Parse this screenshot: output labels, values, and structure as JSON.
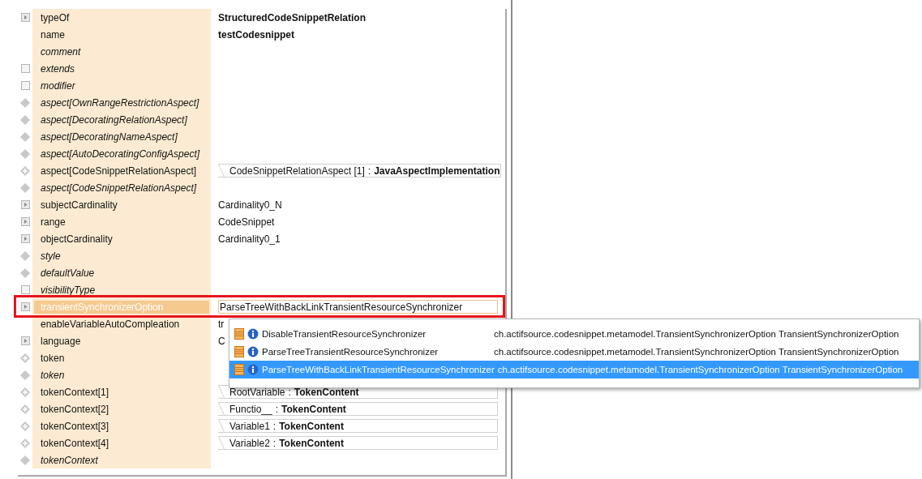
{
  "properties": [
    {
      "label": "typeOf",
      "italic": false,
      "kind": "expander",
      "selected": false,
      "value": {
        "kind": "bold",
        "text": "StructuredCodeSnippetRelation"
      }
    },
    {
      "label": "name",
      "italic": false,
      "kind": "none",
      "selected": false,
      "value": {
        "kind": "bold",
        "text": "testCodesnippet"
      }
    },
    {
      "label": "comment",
      "italic": true,
      "kind": "none",
      "selected": false
    },
    {
      "label": "extends",
      "italic": true,
      "kind": "square",
      "selected": false
    },
    {
      "label": "modifier",
      "italic": true,
      "kind": "square",
      "selected": false
    },
    {
      "label": "aspect[OwnRangeRestrictionAspect]",
      "italic": true,
      "kind": "diamond",
      "selected": false
    },
    {
      "label": "aspect[DecoratingRelationAspect]",
      "italic": true,
      "kind": "diamond",
      "selected": false
    },
    {
      "label": "aspect[DecoratingNameAspect]",
      "italic": true,
      "kind": "diamond",
      "selected": false
    },
    {
      "label": "aspect[AutoDecoratingConfigAspect]",
      "italic": true,
      "kind": "diamond",
      "selected": false
    },
    {
      "label": "aspect[CodeSnippetRelationAspect]",
      "italic": false,
      "kind": "plus",
      "selected": false,
      "value": {
        "kind": "ref",
        "name": "CodeSnippetRelationAspect [1]",
        "separator": ":",
        "type": "JavaAspectImplementation"
      }
    },
    {
      "label": "aspect[CodeSnippetRelationAspect]",
      "italic": true,
      "kind": "diamond",
      "selected": false
    },
    {
      "label": "subjectCardinality",
      "italic": false,
      "kind": "expander",
      "selected": false,
      "value": {
        "kind": "text",
        "text": "Cardinality0_N"
      }
    },
    {
      "label": "range",
      "italic": false,
      "kind": "expander",
      "selected": false,
      "value": {
        "kind": "text",
        "text": "CodeSnippet"
      }
    },
    {
      "label": "objectCardinality",
      "italic": false,
      "kind": "expander",
      "selected": false,
      "value": {
        "kind": "text",
        "text": "Cardinality0_1"
      }
    },
    {
      "label": "style",
      "italic": true,
      "kind": "diamond",
      "selected": false
    },
    {
      "label": "defaultValue",
      "italic": true,
      "kind": "diamond",
      "selected": false
    },
    {
      "label": "visibilityType",
      "italic": true,
      "kind": "square",
      "selected": false
    },
    {
      "label": "transientSynchronizerOption",
      "italic": false,
      "kind": "expander",
      "selected": true,
      "value": {
        "kind": "field",
        "text": "ParseTreeWithBackLinkTransientResourceSynchronizer"
      }
    },
    {
      "label": "enableVariableAutoCompleation",
      "italic": false,
      "kind": "none",
      "selected": false,
      "value": {
        "kind": "text",
        "text": "tr"
      }
    },
    {
      "label": "language",
      "italic": false,
      "kind": "expander",
      "selected": false,
      "value": {
        "kind": "text",
        "text": "C"
      }
    },
    {
      "label": "token",
      "italic": false,
      "kind": "plus",
      "selected": false
    },
    {
      "label": "token",
      "italic": true,
      "kind": "diamond",
      "selected": false
    },
    {
      "label": "tokenContext[1]",
      "italic": false,
      "kind": "plus",
      "selected": false,
      "value": {
        "kind": "ref",
        "name": "RootVariable",
        "separator": ":",
        "type": "TokenContent"
      }
    },
    {
      "label": "tokenContext[2]",
      "italic": false,
      "kind": "plus",
      "selected": false,
      "value": {
        "kind": "ref",
        "name": "Functio__",
        "separator": ":",
        "type": "TokenContent"
      }
    },
    {
      "label": "tokenContext[3]",
      "italic": false,
      "kind": "plus",
      "selected": false,
      "value": {
        "kind": "ref",
        "name": "Variable1",
        "separator": ":",
        "type": "TokenContent"
      }
    },
    {
      "label": "tokenContext[4]",
      "italic": false,
      "kind": "plus",
      "selected": false,
      "value": {
        "kind": "ref",
        "name": "Variable2",
        "separator": ":",
        "type": "TokenContent"
      }
    },
    {
      "label": "tokenContext",
      "italic": true,
      "kind": "diamond",
      "selected": false
    }
  ],
  "proposals": [
    {
      "name": "DisableTransientResourceSynchronizer",
      "qualified": "ch.actifsource.codesnippet.metamodel.TransientSynchronizerOption TransientSynchronizerOption",
      "selected": false
    },
    {
      "name": "ParseTreeTransientResourceSynchronizer",
      "qualified": "ch.actifsource.codesnippet.metamodel.TransientSynchronizerOption TransientSynchronizerOption",
      "selected": false
    },
    {
      "name": "ParseTreeWithBackLinkTransientResourceSynchronizer",
      "qualified": "ch.actifsource.codesnippet.metamodel.TransientSynchronizerOption TransientSynchronizerOption",
      "selected": true
    }
  ]
}
